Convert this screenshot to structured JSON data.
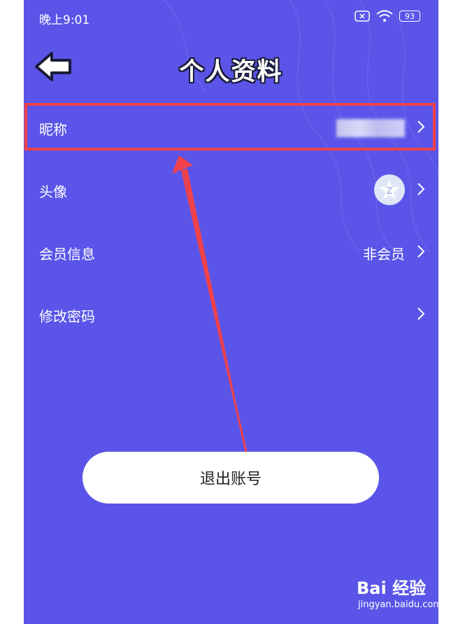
{
  "status_bar": {
    "time": "晚上9:01",
    "battery": "93"
  },
  "header": {
    "title": "个人资料"
  },
  "rows": [
    {
      "label": "昵称",
      "value": ""
    },
    {
      "label": "头像",
      "value": ""
    },
    {
      "label": "会员信息",
      "value": "非会员"
    },
    {
      "label": "修改密码",
      "value": ""
    }
  ],
  "logout_label": "退出账号",
  "watermark": {
    "brand": "Bai 经验",
    "url": "jingyan.baidu.com"
  },
  "colors": {
    "background": "#5a55e8",
    "highlight": "#f0414a",
    "button": "#ffffff"
  }
}
